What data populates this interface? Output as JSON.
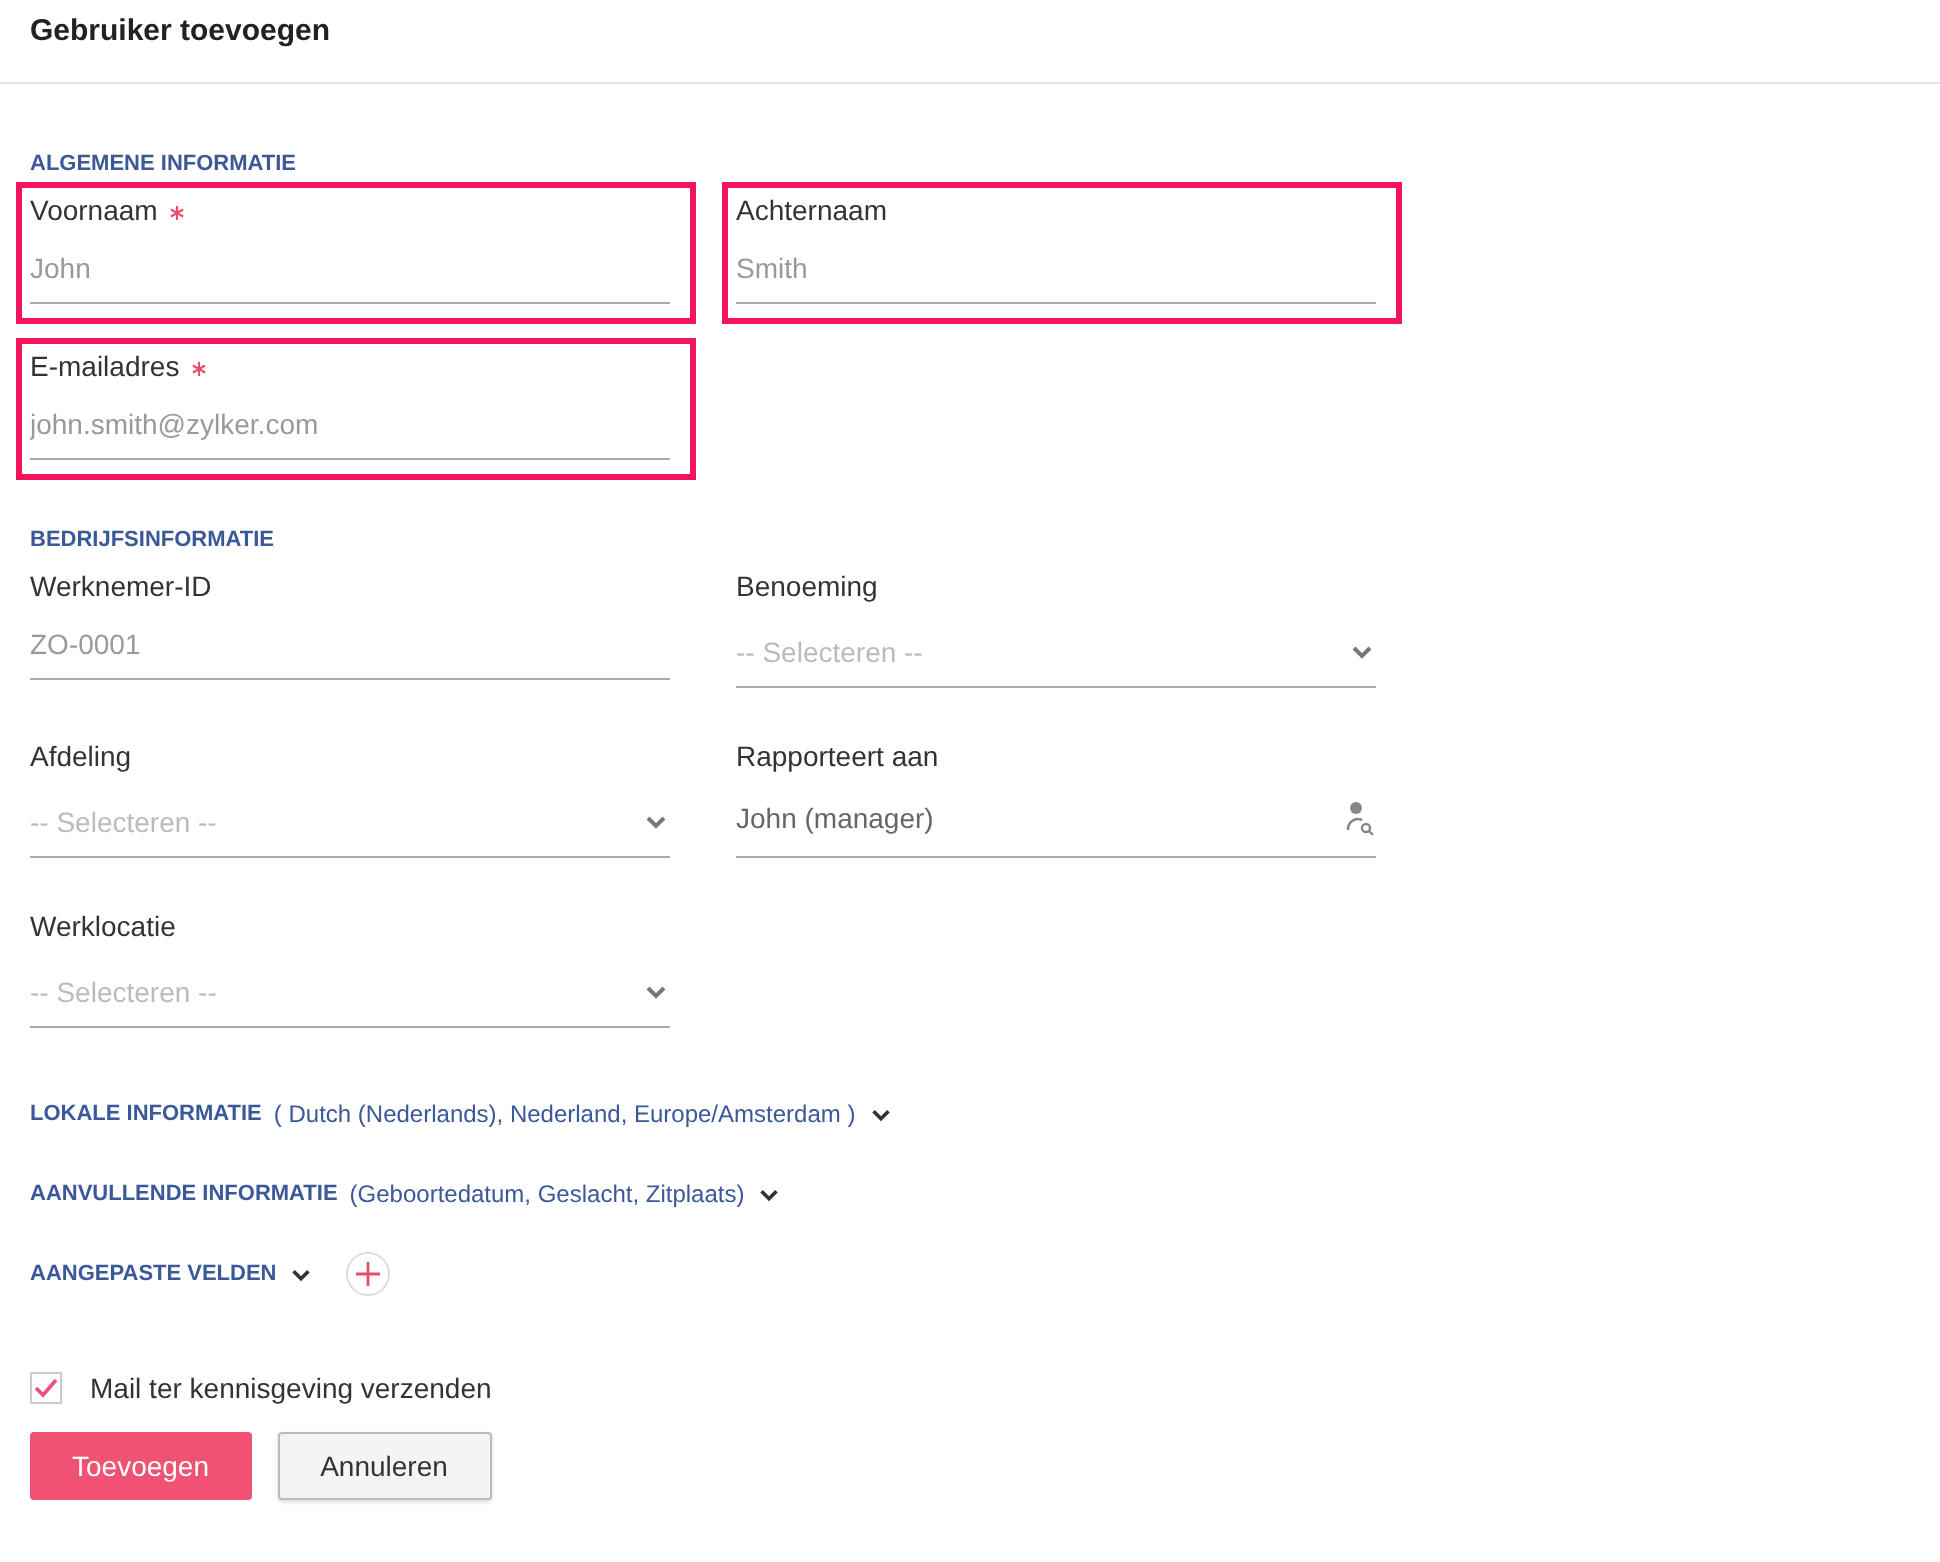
{
  "title": "Gebruiker toevoegen",
  "sections": [
    {
      "heading": "ALGEMENE INFORMATIE",
      "fields": [
        {
          "kind": "text",
          "label": "Voornaam",
          "required": true,
          "placeholder": "John",
          "highlighted": true
        },
        {
          "kind": "text",
          "label": "Achternaam",
          "required": false,
          "placeholder": "Smith",
          "highlighted": true
        },
        {
          "kind": "text",
          "label": "E-mailadres",
          "required": true,
          "placeholder": "john.smith@zylker.com",
          "highlighted": true
        }
      ]
    },
    {
      "heading": "BEDRIJFSINFORMATIE",
      "fields": [
        {
          "kind": "text",
          "label": "Werknemer-ID",
          "required": false,
          "placeholder": "ZO-0001",
          "highlighted": false
        },
        {
          "kind": "select",
          "label": "Benoeming",
          "required": false,
          "placeholder": "-- Selecteren --",
          "highlighted": false
        },
        {
          "kind": "select",
          "label": "Afdeling",
          "required": false,
          "placeholder": "-- Selecteren --",
          "highlighted": false
        },
        {
          "kind": "lookup",
          "label": "Rapporteert aan",
          "required": false,
          "value": "John (manager)",
          "highlighted": false
        },
        {
          "kind": "select",
          "label": "Werklocatie",
          "required": false,
          "placeholder": "-- Selecteren --",
          "highlighted": false
        }
      ]
    }
  ],
  "collapsibles": [
    {
      "kind": "summary",
      "heading": "LOKALE INFORMATIE",
      "summary": "( Dutch (Nederlands), Nederland, Europe/Amsterdam )",
      "expanded": false
    },
    {
      "kind": "summary",
      "heading": "AANVULLENDE INFORMATIE",
      "summary": "(Geboortedatum, Geslacht, Zitplaats)",
      "expanded": false
    },
    {
      "kind": "add",
      "heading": "AANGEPASTE VELDEN",
      "expanded": false
    }
  ],
  "notify": {
    "label": "Mail ter kennisgeving verzenden",
    "checked": true
  },
  "buttons": [
    {
      "label": "Toevoegen",
      "kind": "primary"
    },
    {
      "label": "Annuleren",
      "kind": "secondary"
    }
  ]
}
